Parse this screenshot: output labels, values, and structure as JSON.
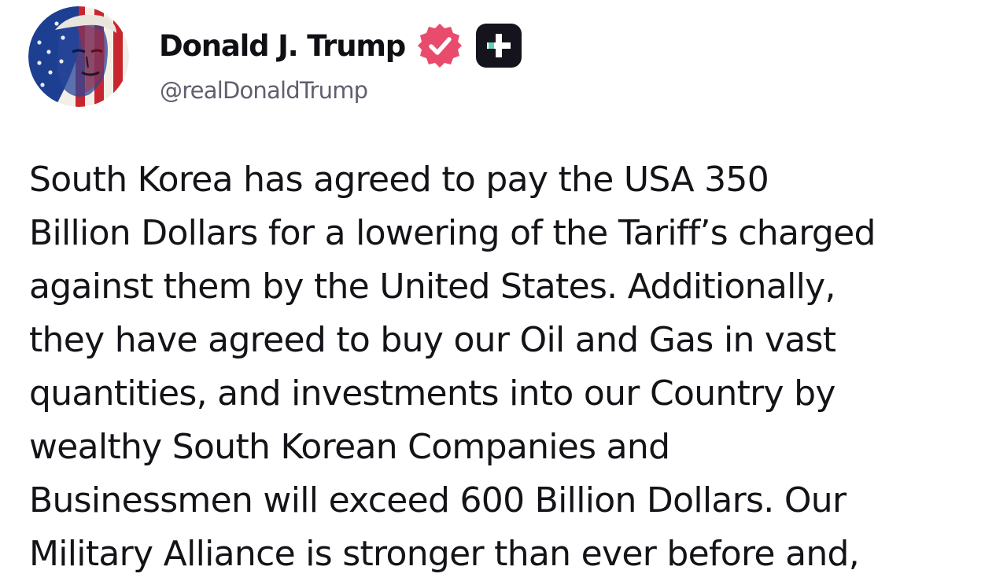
{
  "author": {
    "display_name": "Donald J. Trump",
    "handle": "@realDonaldTrump",
    "avatar_icon": "flag-portrait-avatar",
    "verified_icon": "verified-badge-icon",
    "verified_color": "#e84b6c",
    "plus_icon": "truth-plus-icon",
    "plus_color": "#15141d"
  },
  "post": {
    "text": "South Korea has agreed to pay the USA 350\nBillion Dollars for a lowering of the Tariff’s charged\nagainst them by the United States. Additionally,\nthey have agreed to buy our Oil and Gas in vast\nquantities, and investments into our Country by\nwealthy South Korean Companies and\nBusinessmen will exceed 600 Billion Dollars. Our\nMilitary Alliance is stronger than ever before and,"
  }
}
